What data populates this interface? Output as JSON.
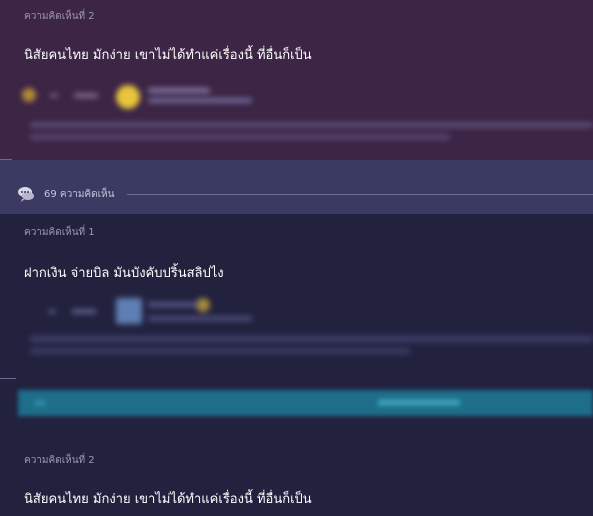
{
  "comments": [
    {
      "label": "ความคิดเห็นที่ 2",
      "text": "นิสัยคนไทย มักง่าย เขาไม่ได้ทำแค่เรื่องนี้ ที่อื่นก็เป็น"
    },
    {
      "label": "ความคิดเห็นที่ 1",
      "text": "ฝากเงิน จ่ายบิล มันบังคับปริ้นสลิปไง"
    },
    {
      "label": "ความคิดเห็นที่ 2",
      "text": "นิสัยคนไทย มักง่าย เขาไม่ได้ทำแค่เรื่องนี้ ที่อื่นก็เป็น"
    }
  ],
  "comment_count": {
    "text": "69 ความคิดเห็น",
    "icon": "chat-bubbles-icon"
  },
  "colors": {
    "top_background": "#3c2545",
    "band_background": "#3a3a63",
    "main_background": "#22223f",
    "action_bar": "#1e6e8a"
  }
}
